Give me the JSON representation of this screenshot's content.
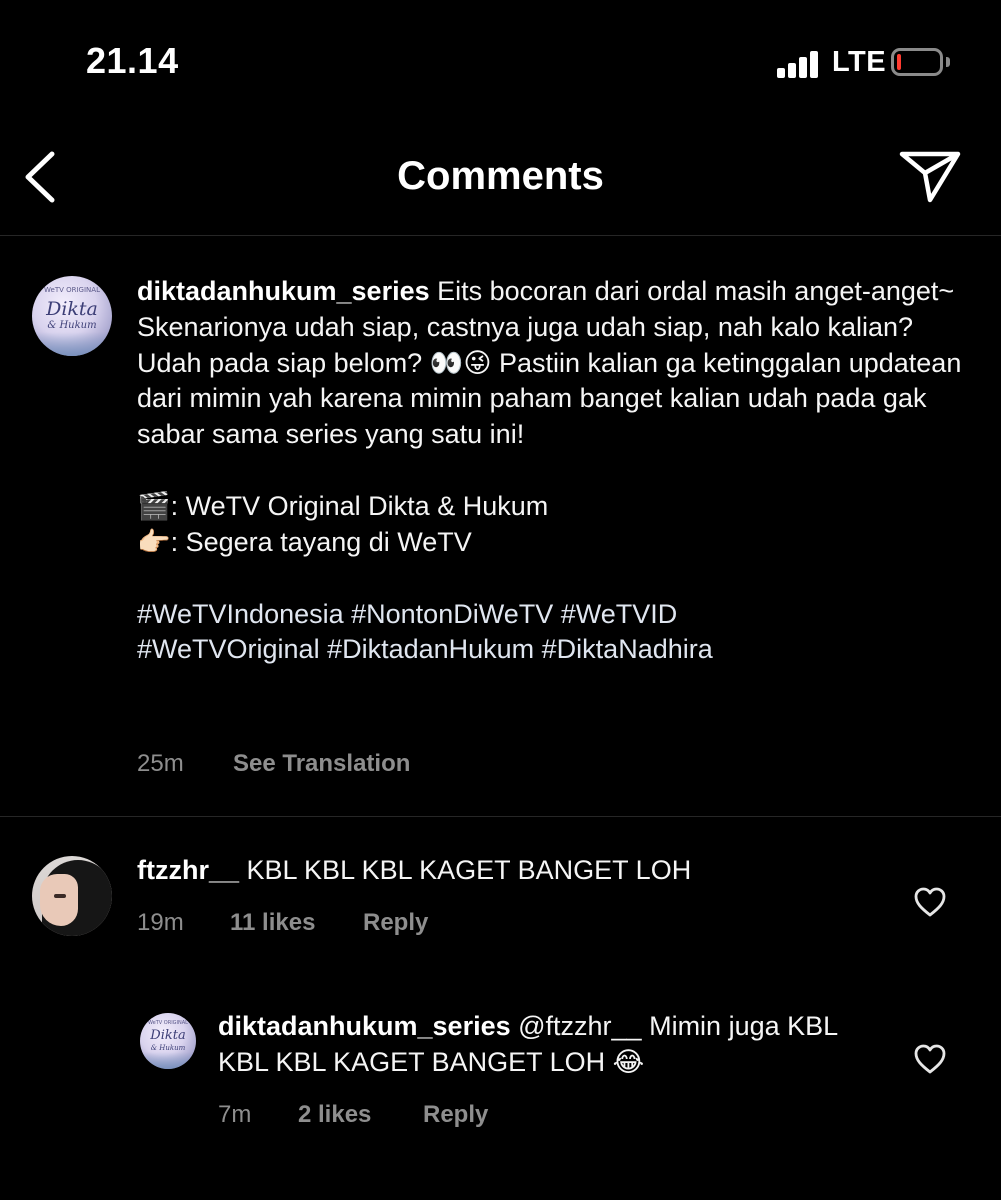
{
  "status_bar": {
    "time": "21.14",
    "network": "LTE",
    "battery_level": 0.1,
    "battery_color": "#ff3b30"
  },
  "header": {
    "title": "Comments",
    "back_icon": "chevron-left-icon",
    "share_icon": "paper-plane-icon"
  },
  "caption": {
    "avatar_brand_top": "WeTV ORIGINAL",
    "avatar_brand_script_1": "Dikta",
    "avatar_brand_script_2": "& Hukum",
    "username": "diktadanhukum_series",
    "text_1": " Eits bocoran dari ordal masih anget-anget~ Skenarionya udah siap, castnya juga udah siap, nah kalo kalian? Udah pada siap belom? ",
    "emoji_1": "👀😜",
    "text_2": "Pastiin kalian ga ketinggalan updatean dari mimin yah karena mimin paham banget kalian udah pada gak sabar sama series yang satu ini!",
    "line_1_emoji": "🎬",
    "line_1_text": ": WeTV Original Dikta & Hukum",
    "line_2_emoji": "👉🏻",
    "line_2_text": ": Segera tayang di WeTV",
    "hashtags_1": "#WeTVIndonesia #NontonDiWeTV #WeTVID",
    "hashtags_2": "#WeTVOriginal #DiktadanHukum #DiktaNadhira",
    "time": "25m",
    "see_translation": "See Translation"
  },
  "comments": [
    {
      "username": "ftzzhr__",
      "text": " KBL KBL KBL KAGET BANGET LOH",
      "time": "19m",
      "likes": "11 likes",
      "reply_label": "Reply",
      "like_icon": "heart-outline-icon"
    }
  ],
  "replies": [
    {
      "username": "diktadanhukum_series",
      "mention": " @ftzzhr__",
      "text": " Mimin juga KBL KBL KBL KAGET BANGET LOH ",
      "emoji": "😂",
      "time": "7m",
      "likes": "2 likes",
      "reply_label": "Reply",
      "like_icon": "heart-outline-icon"
    }
  ]
}
